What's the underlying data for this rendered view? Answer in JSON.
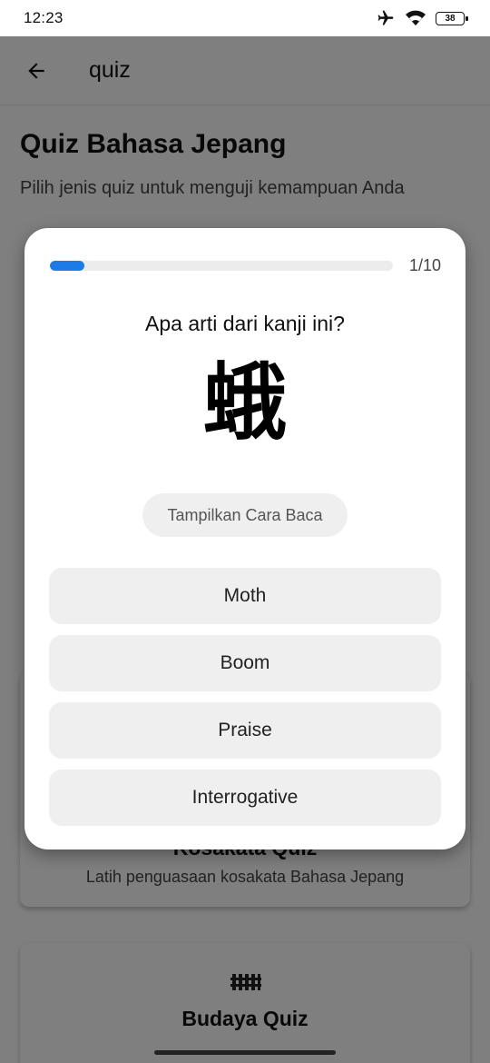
{
  "status_bar": {
    "time": "12:23",
    "battery": "38",
    "icons": [
      "airplane-icon",
      "wifi-icon",
      "battery-icon"
    ]
  },
  "app_bar": {
    "title": "quiz",
    "back_icon": "arrow-left-icon"
  },
  "page": {
    "title": "Quiz Bahasa Jepang",
    "subtitle": "Pilih jenis quiz untuk menguji kemampuan Anda",
    "cards": [
      {
        "title": "Kosakata Quiz",
        "description": "Latih penguasaan kosakata Bahasa Jepang"
      },
      {
        "title": "Budaya Quiz",
        "icon": "fence-icon"
      }
    ]
  },
  "quiz_dialog": {
    "progress_fraction": 0.1,
    "progress_label": "1/10",
    "question": "Apa arti dari kanji ini?",
    "kanji": "蛾",
    "show_reading_label": "Tampilkan Cara Baca",
    "options": [
      "Moth",
      "Boom",
      "Praise",
      "Interrogative"
    ]
  },
  "colors": {
    "accent": "#1e7be6",
    "option_bg": "#efefef",
    "scrim": "rgba(0,0,0,0.5)"
  }
}
